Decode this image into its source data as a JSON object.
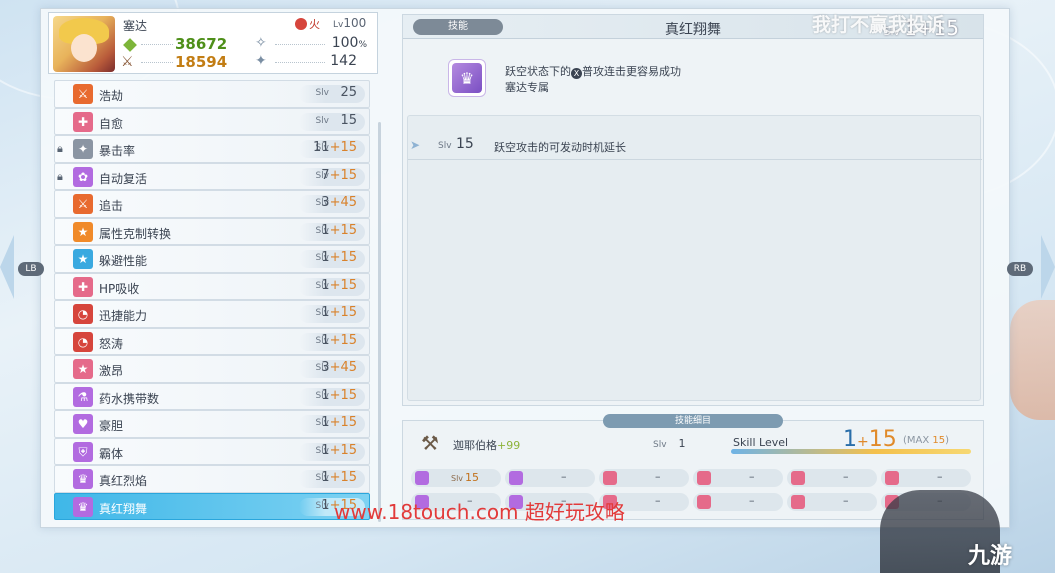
{
  "character": {
    "name": "塞达",
    "element": "火",
    "level_label": "Lv",
    "level": "100",
    "hp": "38672",
    "attack": "18594",
    "crit": "100",
    "crit_unit": "%",
    "skill_stat": "142"
  },
  "skills": [
    {
      "name": "浩劫",
      "slv_label": "Slv",
      "base": "25",
      "bonus": "",
      "icon_color": "#e86a2f",
      "icon": "sword-icon",
      "locked": false,
      "selected": false
    },
    {
      "name": "自愈",
      "slv_label": "Slv",
      "base": "15",
      "bonus": "",
      "icon_color": "#e56a8a",
      "icon": "cross-icon",
      "locked": false,
      "selected": false
    },
    {
      "name": "暴击率",
      "slv_label": "Slv",
      "base": "11",
      "bonus": "+15",
      "icon_color": "#8b95a3",
      "icon": "crit-icon",
      "locked": true,
      "selected": false
    },
    {
      "name": "自动复活",
      "slv_label": "Slv",
      "base": "7",
      "bonus": "+15",
      "icon_color": "#b26be0",
      "icon": "revive-icon",
      "locked": true,
      "selected": false
    },
    {
      "name": "追击",
      "slv_label": "Slv",
      "base": "3",
      "bonus": "+45",
      "icon_color": "#e86a2f",
      "icon": "sword-icon",
      "locked": false,
      "selected": false
    },
    {
      "name": "属性克制转换",
      "slv_label": "Slv",
      "base": "1",
      "bonus": "+15",
      "icon_color": "#f08a2a",
      "icon": "star-icon",
      "locked": false,
      "selected": false
    },
    {
      "name": "躲避性能",
      "slv_label": "Slv",
      "base": "1",
      "bonus": "+15",
      "icon_color": "#3aa9e0",
      "icon": "star-icon",
      "locked": false,
      "selected": false
    },
    {
      "name": "HP吸收",
      "slv_label": "Slv",
      "base": "1",
      "bonus": "+15",
      "icon_color": "#e56a8a",
      "icon": "cross-icon",
      "locked": false,
      "selected": false
    },
    {
      "name": "迅捷能力",
      "slv_label": "Slv",
      "base": "1",
      "bonus": "+15",
      "icon_color": "#d6453c",
      "icon": "speed-icon",
      "locked": false,
      "selected": false
    },
    {
      "name": "怒涛",
      "slv_label": "Slv",
      "base": "1",
      "bonus": "+15",
      "icon_color": "#d6453c",
      "icon": "speed-icon",
      "locked": false,
      "selected": false
    },
    {
      "name": "激昂",
      "slv_label": "Slv",
      "base": "3",
      "bonus": "+45",
      "icon_color": "#e56a8a",
      "icon": "star-icon",
      "locked": false,
      "selected": false
    },
    {
      "name": "药水携带数",
      "slv_label": "Slv",
      "base": "1",
      "bonus": "+15",
      "icon_color": "#b26be0",
      "icon": "potion-icon",
      "locked": false,
      "selected": false
    },
    {
      "name": "豪胆",
      "slv_label": "Slv",
      "base": "1",
      "bonus": "+15",
      "icon_color": "#b26be0",
      "icon": "heart-icon",
      "locked": false,
      "selected": false
    },
    {
      "name": "霸体",
      "slv_label": "Slv",
      "base": "1",
      "bonus": "+15",
      "icon_color": "#b26be0",
      "icon": "shield-icon",
      "locked": false,
      "selected": false
    },
    {
      "name": "真红烈焰",
      "slv_label": "Slv",
      "base": "1",
      "bonus": "+15",
      "icon_color": "#b26be0",
      "icon": "character-icon",
      "locked": false,
      "selected": false
    },
    {
      "name": "真红翔舞",
      "slv_label": "Slv",
      "base": "1",
      "bonus": "+15",
      "icon_color": "#b26be0",
      "icon": "character-icon",
      "locked": false,
      "selected": true
    }
  ],
  "detail": {
    "tag": "技能",
    "title": "真红翔舞",
    "slv_label": "Slv",
    "slv_value": "1+15",
    "desc_pre": "跃空状态下的",
    "desc_button": "X",
    "desc_post": "普攻连击更容易成功",
    "desc_line2": "塞达专属",
    "effects": [
      {
        "label": "Slv",
        "level": "15",
        "text": "跃空攻击的可发动时机延长"
      }
    ]
  },
  "bottom": {
    "tag": "技能细目",
    "weapon_name": "迦耶伯格",
    "weapon_bonus": "+99",
    "slv_label": "Slv",
    "slv_value": "1",
    "skill_level_label": "Skill Level",
    "skill_level_base": "1",
    "skill_level_plus": "+",
    "skill_level_bonus": "15",
    "max_label": "MAX",
    "max_value": "15",
    "slots_row1": [
      {
        "label": "Slv",
        "value": "15"
      },
      {
        "label": "",
        "value": "–"
      },
      {
        "label": "",
        "value": "–"
      },
      {
        "label": "",
        "value": "–"
      },
      {
        "label": "",
        "value": "–"
      },
      {
        "label": "",
        "value": "–"
      }
    ],
    "slots_row2": [
      {
        "label": "",
        "value": "–"
      },
      {
        "label": "",
        "value": "–"
      },
      {
        "label": "",
        "value": "–"
      },
      {
        "label": "",
        "value": "–"
      },
      {
        "label": "",
        "value": "–"
      },
      {
        "label": "",
        "value": "–"
      }
    ]
  },
  "nav": {
    "left": "LB",
    "right": "RB"
  },
  "watermarks": {
    "top": "我打不赢我投诉",
    "bottom": "www.18touch.com 超好玩攻略",
    "logo": "九游"
  }
}
